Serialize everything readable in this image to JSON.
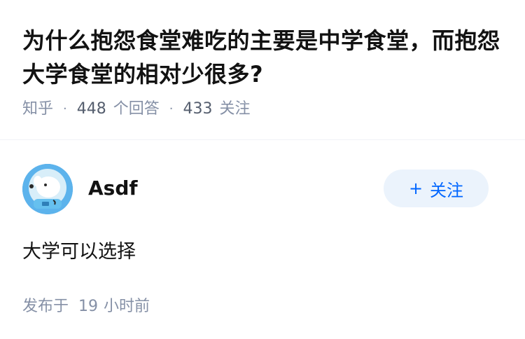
{
  "question": {
    "title": "为什么抱怨食堂难吃的主要是中学食堂，而抱怨大学食堂的相对少很多?",
    "source": "知乎",
    "separator": "·",
    "answer_count": "448",
    "answer_label": "个回答",
    "follow_count": "433",
    "follow_label": "关注"
  },
  "answer": {
    "author_name": "Asdf",
    "follow_button": "关注",
    "follow_plus": "+",
    "content": "大学可以选择",
    "time_prefix": "发布于",
    "time_value": "19",
    "time_suffix": "小时前"
  },
  "colors": {
    "accent": "#0066ff",
    "follow_bg": "#ebf3fc",
    "meta": "#8590a6"
  }
}
